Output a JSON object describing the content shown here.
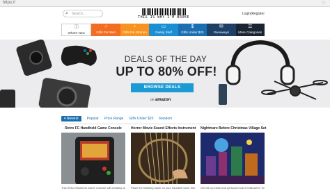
{
  "browser": {
    "url": "https://"
  },
  "header": {
    "search_placeholder": "Search...",
    "logo_tagline": "THIS IS WHY I'M BROKE",
    "login": "Login",
    "separator": "|",
    "register": "Register"
  },
  "nav": {
    "items": [
      {
        "label": "What's New",
        "icon": "info-icon",
        "color": "#ffffff"
      },
      {
        "label": "Gifts For Men",
        "icon": "male-icon",
        "color": "#f26d21"
      },
      {
        "label": "Gifts For Women",
        "icon": "female-icon",
        "color": "#f7931e"
      },
      {
        "label": "Geeky Stuff",
        "icon": "monitor-icon",
        "color": "#1b8fd2"
      },
      {
        "label": "Gifts Under $20",
        "icon": "dollar-icon",
        "color": "#1b6fb0"
      },
      {
        "label": "Giveaways",
        "icon": "gift-icon",
        "color": "#1e3f66"
      },
      {
        "label": "More Categories",
        "icon": "grid-icon",
        "color": "#1a2533"
      }
    ],
    "strip_colors": [
      "#e84e1b",
      "#f26d21",
      "#f7931e",
      "#7ac6ea",
      "#1b8fd2",
      "#1b6fb0",
      "#1e3f66",
      "#1a2533"
    ]
  },
  "hero": {
    "headline": "DEALS OF THE DAY",
    "offer": "UP TO 80% OFF!",
    "cta": "BROWSE DEALS",
    "on_label": "on",
    "brand": "amazon"
  },
  "tabs": [
    {
      "label": "Newest",
      "active": true
    },
    {
      "label": "Popular"
    },
    {
      "label": "Price Range"
    },
    {
      "label": "Gifts Under $20"
    },
    {
      "label": "Random"
    }
  ],
  "products": [
    {
      "title": "Retro FC Handheld Game Console",
      "desc": "This Retro Handheld Game Console will certainly take you back to the good old days. With 168 built-in games,"
    },
    {
      "title": "Horror Movie Sound Effects Instrument",
      "desc": "Place the finishing touch on your haunted home this Halloween by adding an eerie soundtrack using this"
    },
    {
      "title": "Nightmare Before Christmas Village Set",
      "desc": "Get the up close and personal look of Halloween Town you've always dreamed of by adding this Nightmare"
    }
  ],
  "colors": {
    "accent": "#1b9ad6",
    "link": "#1b6fb0"
  }
}
